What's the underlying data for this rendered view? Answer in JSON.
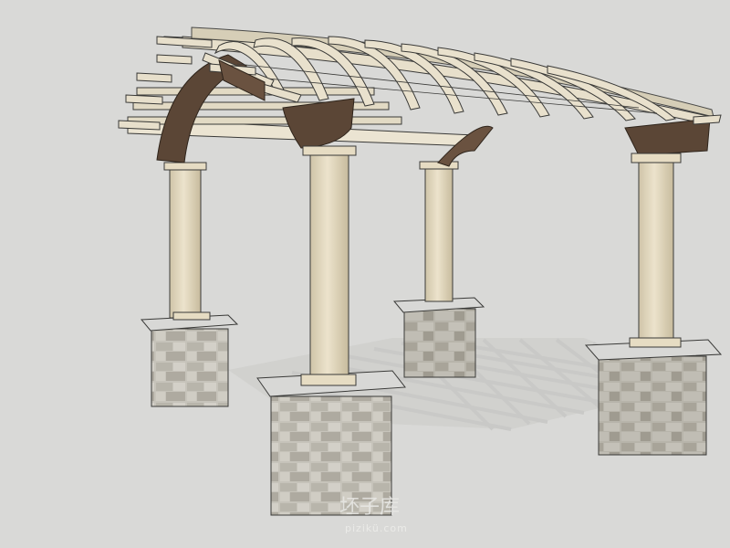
{
  "scene": {
    "subject": "pergola-3d-model",
    "watermark": {
      "main": "坯子库",
      "sub": "pizikü.com"
    }
  },
  "colors": {
    "background": "#d9d9d7",
    "shadow": "#c3c3c1",
    "column": "#e6dcc3",
    "column_shade": "#cdc2a6",
    "timber": "#e7dfcb",
    "timber_shade": "#c9bfa4",
    "dark_wood": "#5b4636",
    "stone_light": "#c9c6bd",
    "stone_dark": "#9b978d",
    "cap": "#d8d8d6",
    "outline": "#3a3a38"
  }
}
